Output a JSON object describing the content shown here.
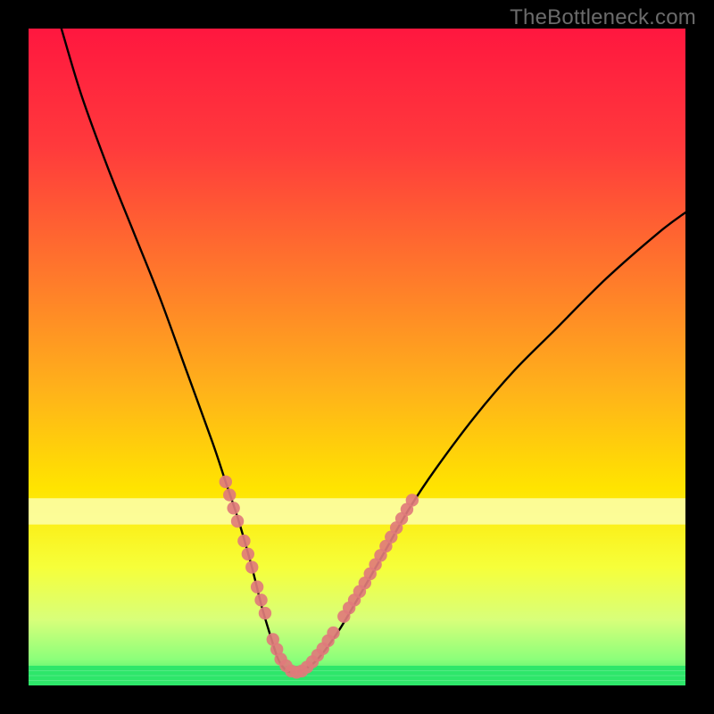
{
  "watermark": "TheBottleneck.com",
  "colors": {
    "page_bg": "#000000",
    "curve": "#000000",
    "marker": "#e07b7b",
    "band_green": "#2ee66a",
    "gradient_stops": [
      {
        "offset": 0.0,
        "color": "#ff173f"
      },
      {
        "offset": 0.18,
        "color": "#ff3a3c"
      },
      {
        "offset": 0.38,
        "color": "#ff7a2b"
      },
      {
        "offset": 0.55,
        "color": "#ffb21a"
      },
      {
        "offset": 0.7,
        "color": "#ffe400"
      },
      {
        "offset": 0.82,
        "color": "#f6ff3a"
      },
      {
        "offset": 0.9,
        "color": "#d8ff7a"
      },
      {
        "offset": 0.96,
        "color": "#8cff7a"
      },
      {
        "offset": 1.0,
        "color": "#2ee66a"
      }
    ]
  },
  "chart_data": {
    "type": "line",
    "title": "",
    "xlabel": "",
    "ylabel": "",
    "xlim": [
      0,
      100
    ],
    "ylim": [
      0,
      100
    ],
    "grid": false,
    "legend": false,
    "series": [
      {
        "name": "bottleneck-curve",
        "x": [
          5,
          8,
          12,
          16,
          20,
          24,
          28,
          30,
          32,
          34,
          35.5,
          37,
          38,
          39,
          40,
          42,
          44,
          47,
          50,
          54,
          58,
          62,
          68,
          74,
          80,
          88,
          96,
          100
        ],
        "y": [
          100,
          90,
          79,
          69,
          59,
          48,
          37,
          31,
          25,
          18,
          12,
          7,
          4,
          2.5,
          2,
          2.5,
          4,
          8,
          13,
          20,
          27,
          33,
          41,
          48,
          54,
          62,
          69,
          72
        ]
      }
    ],
    "markers": {
      "name": "highlight-dots",
      "color": "#e07b7b",
      "points": [
        {
          "x": 30.0,
          "y": 31
        },
        {
          "x": 30.6,
          "y": 29
        },
        {
          "x": 31.2,
          "y": 27
        },
        {
          "x": 31.8,
          "y": 25
        },
        {
          "x": 32.8,
          "y": 22
        },
        {
          "x": 33.4,
          "y": 20
        },
        {
          "x": 34.0,
          "y": 18
        },
        {
          "x": 34.8,
          "y": 15
        },
        {
          "x": 35.4,
          "y": 13
        },
        {
          "x": 36.0,
          "y": 11
        },
        {
          "x": 37.2,
          "y": 7
        },
        {
          "x": 37.8,
          "y": 5.5
        },
        {
          "x": 38.4,
          "y": 4
        },
        {
          "x": 39.2,
          "y": 3
        },
        {
          "x": 40.0,
          "y": 2.2
        },
        {
          "x": 40.8,
          "y": 2
        },
        {
          "x": 41.6,
          "y": 2.2
        },
        {
          "x": 42.4,
          "y": 2.8
        },
        {
          "x": 43.2,
          "y": 3.6
        },
        {
          "x": 44.0,
          "y": 4.6
        },
        {
          "x": 44.8,
          "y": 5.6
        },
        {
          "x": 45.6,
          "y": 6.8
        },
        {
          "x": 46.4,
          "y": 8.0
        },
        {
          "x": 48.0,
          "y": 10.5
        },
        {
          "x": 48.8,
          "y": 11.8
        },
        {
          "x": 49.6,
          "y": 13.0
        },
        {
          "x": 50.4,
          "y": 14.3
        },
        {
          "x": 51.2,
          "y": 15.6
        },
        {
          "x": 52.0,
          "y": 17.0
        },
        {
          "x": 52.8,
          "y": 18.4
        },
        {
          "x": 53.6,
          "y": 19.8
        },
        {
          "x": 54.4,
          "y": 21.2
        },
        {
          "x": 55.2,
          "y": 22.6
        },
        {
          "x": 56.0,
          "y": 24.0
        },
        {
          "x": 56.8,
          "y": 25.4
        },
        {
          "x": 57.6,
          "y": 26.8
        },
        {
          "x": 58.4,
          "y": 28.2
        }
      ]
    },
    "bands": [
      {
        "name": "pale-yellow",
        "y0": 24.5,
        "y1": 28.5,
        "color": "#fbffae",
        "alpha": 0.85
      },
      {
        "name": "green-band",
        "y0": 0,
        "y1": 3.0,
        "color": "#2ee66a",
        "alpha": 1.0
      }
    ]
  }
}
